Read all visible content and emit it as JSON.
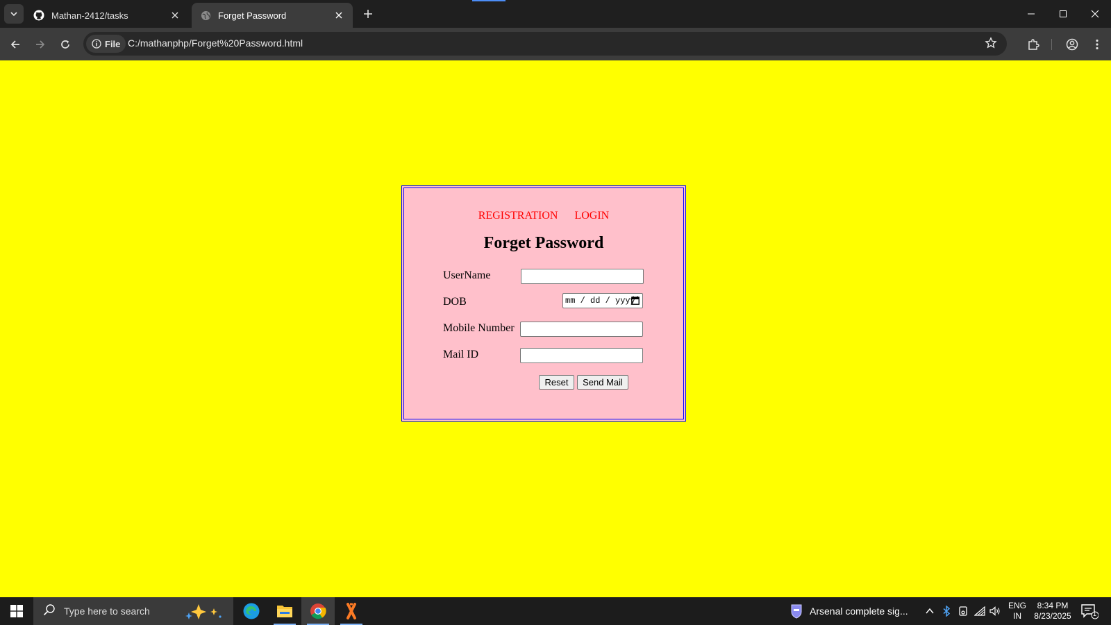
{
  "browser": {
    "tabs": [
      {
        "label": "Mathan-2412/tasks",
        "icon": "github-icon"
      },
      {
        "label": "Forget Password",
        "icon": "globe-icon",
        "active": true
      }
    ],
    "address": {
      "chip_label": "File",
      "url": "C:/mathanphp/Forget%20Password.html"
    }
  },
  "page": {
    "nav_links": [
      "REGISTRATION",
      "LOGIN"
    ],
    "title": "Forget Password",
    "fields": {
      "username_label": "UserName",
      "dob_label": "DOB",
      "dob_placeholder": "mm / dd / yyyy",
      "mobile_label": "Mobile Number",
      "mail_label": "Mail ID"
    },
    "buttons": {
      "reset": "Reset",
      "send": "Send Mail"
    },
    "colors": {
      "background": "#ffff00",
      "panel": "#ffc0cb",
      "border": "#0000ff",
      "link": "#ff0000"
    }
  },
  "taskbar": {
    "search_placeholder": "Type here to search",
    "news_text": "Arsenal complete sig...",
    "lang_line1": "ENG",
    "lang_line2": "IN",
    "time": "8:34 PM",
    "date": "8/23/2025",
    "notification_count": "1"
  }
}
